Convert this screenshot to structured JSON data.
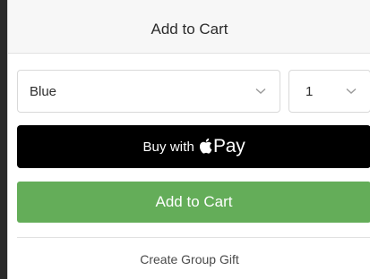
{
  "header": {
    "title": "Add to Cart"
  },
  "options": {
    "color_value": "Blue",
    "quantity_value": "1",
    "chevron_icon": "chevron-down-icon"
  },
  "apple_pay": {
    "prefix": "Buy with",
    "icon": "apple-logo-icon",
    "word": "Pay"
  },
  "add_to_cart": {
    "label": "Add to Cart",
    "color": "#64ad59"
  },
  "group_gift": {
    "label": "Create Group Gift"
  }
}
